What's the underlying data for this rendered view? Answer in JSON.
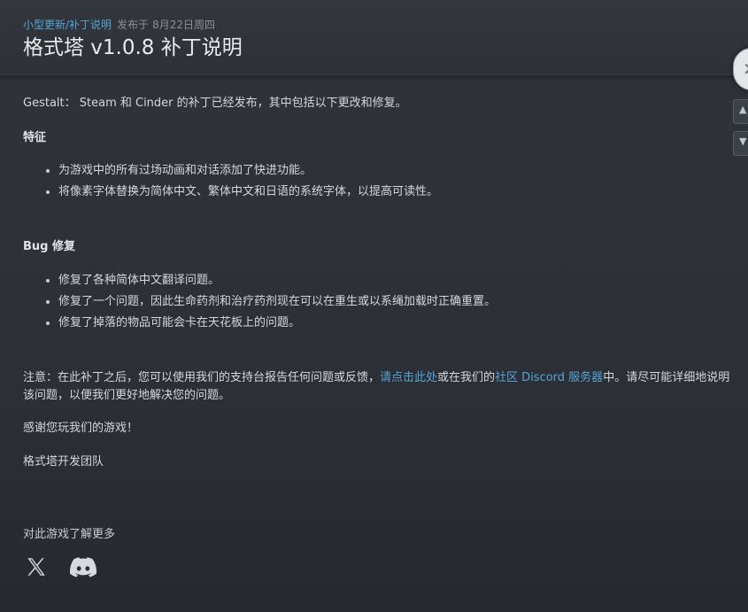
{
  "header": {
    "category": "小型更新/补丁说明",
    "published_label": "发布于",
    "date": "8月22日周四",
    "title": "格式塔 v1.0.8 补丁说明"
  },
  "side_controls": [
    {
      "icon": "close-icon"
    },
    {
      "icon": "chevron-up-icon"
    },
    {
      "icon": "chevron-down-icon"
    }
  ],
  "body": {
    "intro": "Gestalt： Steam 和 Cinder 的补丁已经发布，其中包括以下更改和修复。",
    "features_heading": "特征",
    "features": [
      "为游戏中的所有过场动画和对话添加了快进功能。",
      "将像素字体替换为简体中文、繁体中文和日语的系统字体，以提高可读性。"
    ],
    "bugfix_heading": "Bug 修复",
    "bugfixes": [
      "修复了各种简体中文翻译问题。",
      "修复了一个问题，因此生命药剂和治疗药剂现在可以在重生或以系绳加载时正确重置。",
      "修复了掉落的物品可能会卡在天花板上的问题。"
    ],
    "note": {
      "part1": "注意：在此补丁之后，您可以使用我们的支持台报告任何问题或反馈，",
      "link1": "请点击此处",
      "part2": "或在我们的",
      "link2": "社区 Discord 服务器",
      "part3": "中。请尽可能详细地说明该问题，以便我们更好地解决您的问题。"
    },
    "thanks": "感谢您玩我们的游戏！",
    "signature": "格式塔开发团队"
  },
  "footer": {
    "learn_more": "对此游戏了解更多",
    "socials": [
      {
        "icon": "x-twitter-icon"
      },
      {
        "icon": "discord-icon"
      }
    ]
  },
  "colors": {
    "link": "#53a4d8",
    "text": "#d4d7dc",
    "background": "#2d3036"
  }
}
